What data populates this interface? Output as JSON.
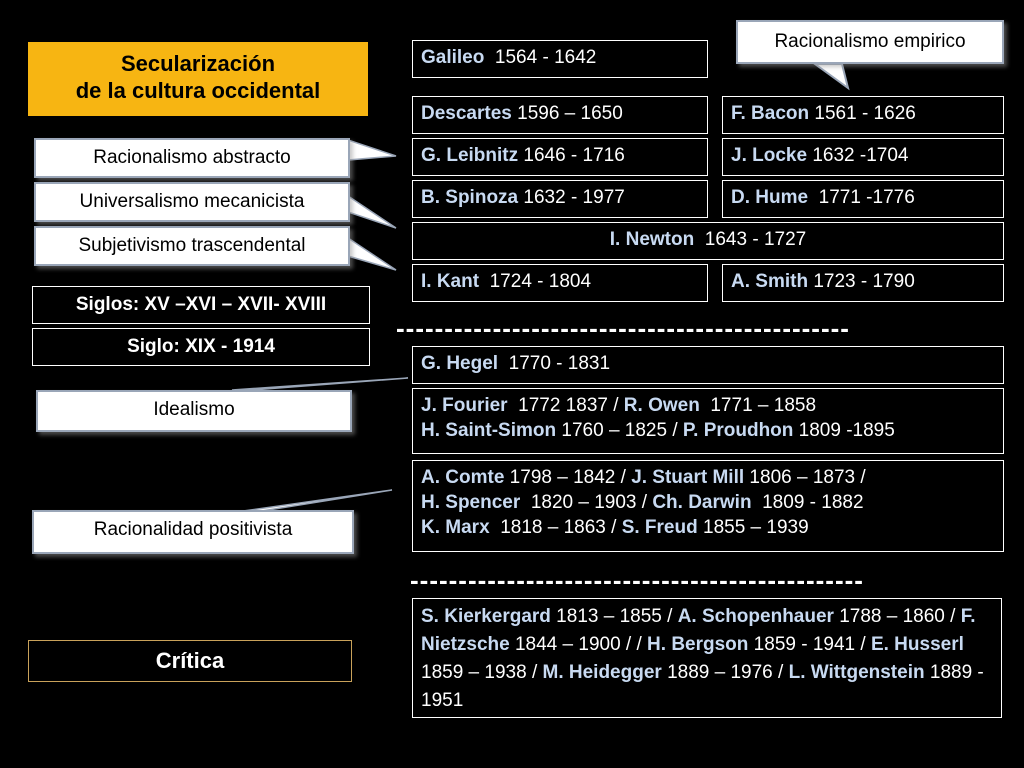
{
  "title": {
    "line1": "Secularización",
    "line2": "de la cultura occidental"
  },
  "callouts": {
    "empirico": "Racionalismo empirico",
    "abstracto": "Racionalismo abstracto",
    "mecanicista": "Universalismo mecanicista",
    "trascendental": "Subjetivismo trascendental",
    "idealismo": "Idealismo",
    "positivista": "Racionalidad positivista"
  },
  "labels": {
    "siglos": "Siglos:  XV –XVI – XVII- XVIII",
    "siglo19": "Siglo:  XIX - 1914",
    "critica": "Crítica"
  },
  "separator": "-----------------------------------------------",
  "people": {
    "galileo": {
      "name": "Galileo",
      "dates": "  1564 - 1642"
    },
    "descartes": {
      "name": "Descartes",
      "dates": " 1596 – 1650"
    },
    "bacon": {
      "name": "F. Bacon",
      "dates": " 1561 - 1626"
    },
    "leibnitz": {
      "name": "G. Leibnitz",
      "dates": " 1646 - 1716"
    },
    "locke": {
      "name": "J. Locke",
      "dates": " 1632 -1704"
    },
    "spinoza": {
      "name": "B. Spinoza",
      "dates": " 1632 - 1977"
    },
    "hume": {
      "name": "D. Hume",
      "dates": "  1771 -1776"
    },
    "newton": {
      "name": "I. Newton",
      "dates": "  1643 - 1727"
    },
    "kant": {
      "name": "I. Kant",
      "dates": "  1724 - 1804"
    },
    "smith": {
      "name": "A. Smith",
      "dates": " 1723 - 1790"
    },
    "hegel": {
      "name": "G. Hegel",
      "dates": "  1770 - 1831"
    }
  },
  "groups": {
    "socialists": [
      {
        "name": "J. Fourier",
        "dates": "  1772 1837 / "
      },
      {
        "name": "R. Owen",
        "dates": "  1771 – 1858"
      },
      {
        "name": "H. Saint-Simon",
        "dates": " 1760 – 1825 / "
      },
      {
        "name": "P. Proudhon",
        "dates": " 1809 -1895"
      }
    ],
    "positivists": [
      {
        "name": "A. Comte",
        "dates": " 1798 – 1842 / "
      },
      {
        "name": "J. Stuart Mill",
        "dates": " 1806 – 1873 /"
      },
      {
        "name": "H. Spencer",
        "dates": "  1820 – 1903 / "
      },
      {
        "name": "Ch. Darwin",
        "dates": "  1809 - 1882"
      },
      {
        "name": "K. Marx",
        "dates": "  1818 – 1863 / "
      },
      {
        "name": "S. Freud",
        "dates": " 1855 – 1939"
      }
    ],
    "critics": [
      {
        "name": "S. Kierkergard",
        "dates": "  1813 – 1855 / "
      },
      {
        "name": "A. Schopenhauer",
        "dates": "  1788 – 1860 / "
      },
      {
        "name": "F. Nietzsche",
        "dates": "  1844 – 1900 / / "
      },
      {
        "name": "H. Bergson",
        "dates": " 1859 - 1941 / "
      },
      {
        "name": "E. Husserl",
        "dates": "  1859 – 1938 / "
      },
      {
        "name": "M. Heidegger",
        "dates": "  1889 – 1976 /  "
      },
      {
        "name": "L. Wittgenstein",
        "dates": "  1889 - 1951"
      }
    ]
  },
  "colors": {
    "background": "#000000",
    "title_bg": "#f7b512",
    "name_color": "#c8daf2",
    "callout_border": "#9aa6b8"
  }
}
